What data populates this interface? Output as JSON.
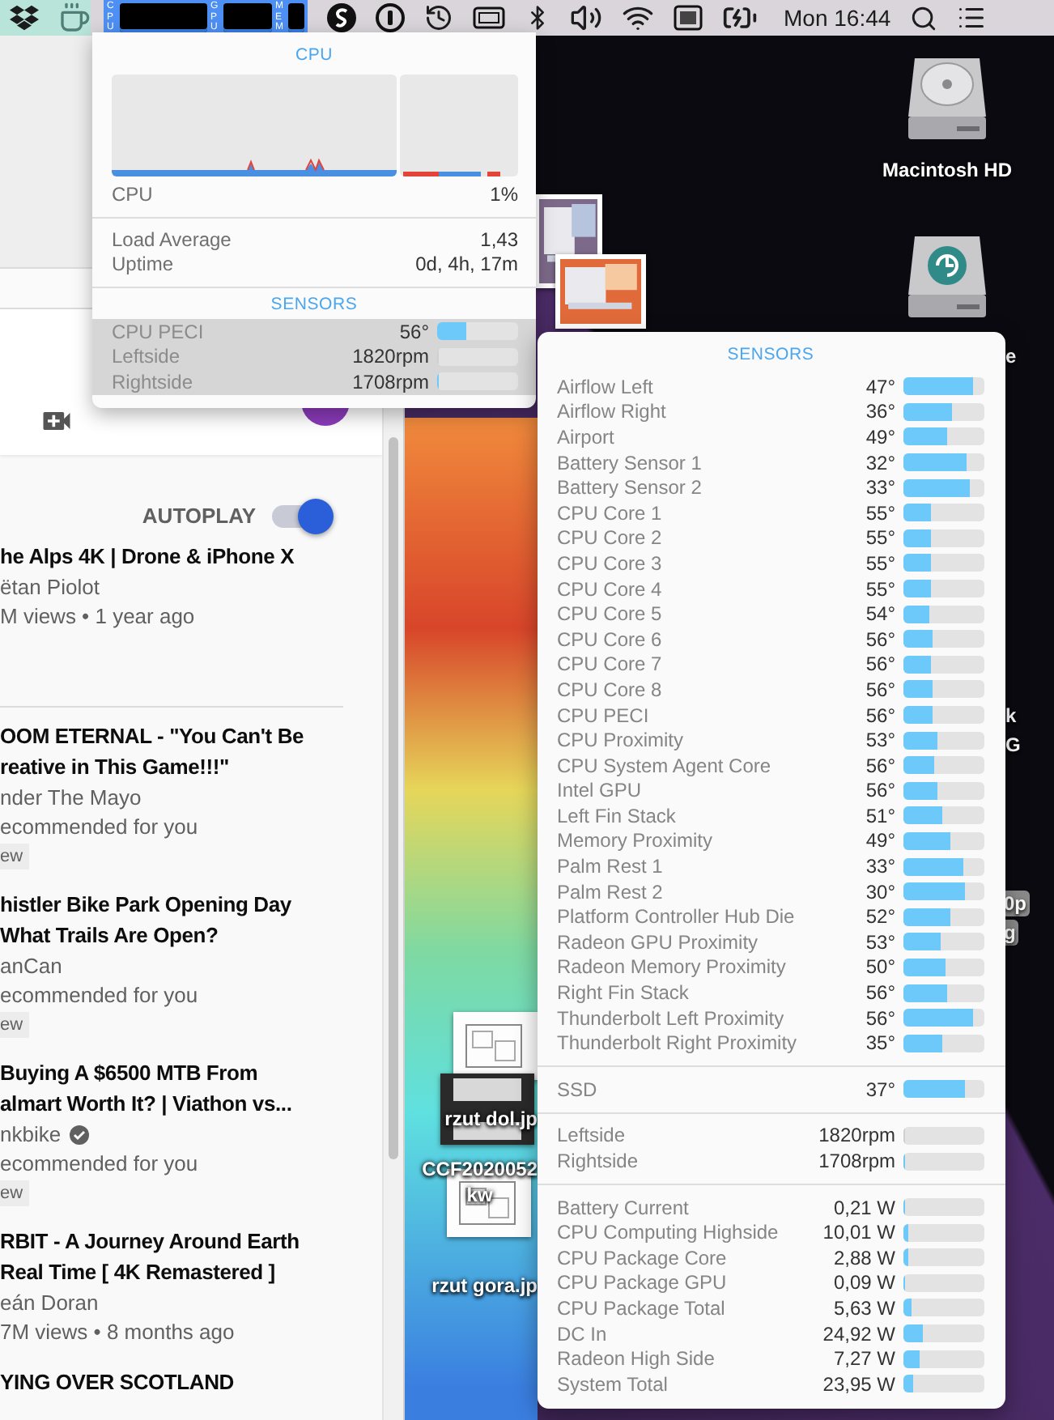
{
  "menu_bar": {
    "meters": [
      {
        "label": "CPU"
      },
      {
        "label": "GPU"
      },
      {
        "label": "MEM"
      }
    ],
    "clock": "Mon 16:44"
  },
  "video_sidebar": {
    "autoplay": {
      "label": "AUTOPLAY",
      "on": true
    },
    "videos": [
      {
        "title_lines": [
          "he Alps 4K | Drone & iPhone X"
        ],
        "channel": "ëtan Piolot",
        "verified": false,
        "meta": "M views • 1 year ago"
      },
      {
        "title_lines": [
          "OOM ETERNAL - \"You Can't Be",
          "reative in This Game!!!\""
        ],
        "channel": "nder The Mayo",
        "verified": false,
        "meta": "ecommended for you",
        "badge": "ew"
      },
      {
        "title_lines": [
          "histler Bike Park Opening Day",
          "What Trails Are Open?"
        ],
        "channel": "anCan",
        "verified": false,
        "meta": "ecommended for you",
        "badge": "ew"
      },
      {
        "title_lines": [
          "Buying A $6500 MTB From",
          "almart Worth It? | Viathon vs..."
        ],
        "channel": "nkbike",
        "verified": true,
        "meta": "ecommended for you",
        "badge": "ew"
      },
      {
        "title_lines": [
          "RBIT - A Journey Around Earth",
          "Real Time [ 4K Remastered ]"
        ],
        "channel": "eán Doran",
        "verified": false,
        "meta": "7M views • 8 months ago"
      },
      {
        "title_lines": [
          "YING OVER SCOTLAND"
        ]
      }
    ]
  },
  "desktop": {
    "drive_label": "Macintosh HD",
    "label_fragments": [
      "e",
      "k",
      "G",
      "0p",
      "g"
    ],
    "files": [
      {
        "label_lines": [
          "rzut dol.jp"
        ]
      },
      {
        "label_lines": [
          "CCF2020052",
          "kw"
        ]
      },
      {
        "label_lines": [
          "rzut gora.jp"
        ]
      }
    ]
  },
  "cpu_popup": {
    "title": "CPU",
    "usage": {
      "label": "CPU",
      "value": "1%"
    },
    "stats": [
      {
        "label": "Load Average",
        "value": "1,43"
      },
      {
        "label": "Uptime",
        "value": "0d, 4h, 17m"
      }
    ],
    "sensors_title": "SENSORS",
    "sensors": [
      {
        "label": "CPU PECI",
        "value": "56°",
        "level": 0.35
      },
      {
        "label": "Leftside",
        "value": "1820rpm",
        "level": 0
      },
      {
        "label": "Rightside",
        "value": "1708rpm",
        "level": 0.02
      }
    ]
  },
  "sensors_popup": {
    "title": "SENSORS",
    "groups": [
      {
        "rows": [
          {
            "label": "Airflow Left",
            "value": "47°",
            "level": 0.86
          },
          {
            "label": "Airflow Right",
            "value": "36°",
            "level": 0.6
          },
          {
            "label": "Airport",
            "value": "49°",
            "level": 0.54
          },
          {
            "label": "Battery Sensor 1",
            "value": "32°",
            "level": 0.78
          },
          {
            "label": "Battery Sensor 2",
            "value": "33°",
            "level": 0.82
          },
          {
            "label": "CPU Core 1",
            "value": "55°",
            "level": 0.34
          },
          {
            "label": "CPU Core 2",
            "value": "55°",
            "level": 0.34
          },
          {
            "label": "CPU Core 3",
            "value": "55°",
            "level": 0.34
          },
          {
            "label": "CPU Core 4",
            "value": "55°",
            "level": 0.34
          },
          {
            "label": "CPU Core 5",
            "value": "54°",
            "level": 0.32
          },
          {
            "label": "CPU Core 6",
            "value": "56°",
            "level": 0.36
          },
          {
            "label": "CPU Core 7",
            "value": "56°",
            "level": 0.34
          },
          {
            "label": "CPU Core 8",
            "value": "56°",
            "level": 0.36
          },
          {
            "label": "CPU PECI",
            "value": "56°",
            "level": 0.36
          },
          {
            "label": "CPU Proximity",
            "value": "53°",
            "level": 0.42
          },
          {
            "label": "CPU System Agent Core",
            "value": "56°",
            "level": 0.38
          },
          {
            "label": "Intel GPU",
            "value": "56°",
            "level": 0.42
          },
          {
            "label": "Left Fin Stack",
            "value": "51°",
            "level": 0.48
          },
          {
            "label": "Memory Proximity",
            "value": "49°",
            "level": 0.58
          },
          {
            "label": "Palm Rest 1",
            "value": "33°",
            "level": 0.74
          },
          {
            "label": "Palm Rest 2",
            "value": "30°",
            "level": 0.76
          },
          {
            "label": "Platform Controller Hub Die",
            "value": "52°",
            "level": 0.58
          },
          {
            "label": "Radeon GPU Proximity",
            "value": "53°",
            "level": 0.46
          },
          {
            "label": "Radeon Memory Proximity",
            "value": "50°",
            "level": 0.52
          },
          {
            "label": "Right Fin Stack",
            "value": "56°",
            "level": 0.54
          },
          {
            "label": "Thunderbolt Left Proximity",
            "value": "56°",
            "level": 0.86
          },
          {
            "label": "Thunderbolt Right Proximity",
            "value": "35°",
            "level": 0.48
          }
        ]
      },
      {
        "rows": [
          {
            "label": "SSD",
            "value": "37°",
            "level": 0.76
          }
        ]
      },
      {
        "rows": [
          {
            "label": "Leftside",
            "value": "1820rpm",
            "level": 0
          },
          {
            "label": "Rightside",
            "value": "1708rpm",
            "level": 0.02
          }
        ]
      },
      {
        "rows": [
          {
            "label": "Battery Current",
            "value": "0,21 W",
            "level": 0.02
          },
          {
            "label": "CPU Computing Highside",
            "value": "10,01 W",
            "level": 0.05
          },
          {
            "label": "CPU Package Core",
            "value": "2,88 W",
            "level": 0.06
          },
          {
            "label": "CPU Package GPU",
            "value": "0,09 W",
            "level": 0.01
          },
          {
            "label": "CPU Package Total",
            "value": "5,63 W",
            "level": 0.09
          },
          {
            "label": "DC In",
            "value": "24,92 W",
            "level": 0.24
          },
          {
            "label": "Radeon High Side",
            "value": "7,27 W",
            "level": 0.2
          },
          {
            "label": "System Total",
            "value": "23,95 W",
            "level": 0.12
          }
        ]
      }
    ]
  }
}
